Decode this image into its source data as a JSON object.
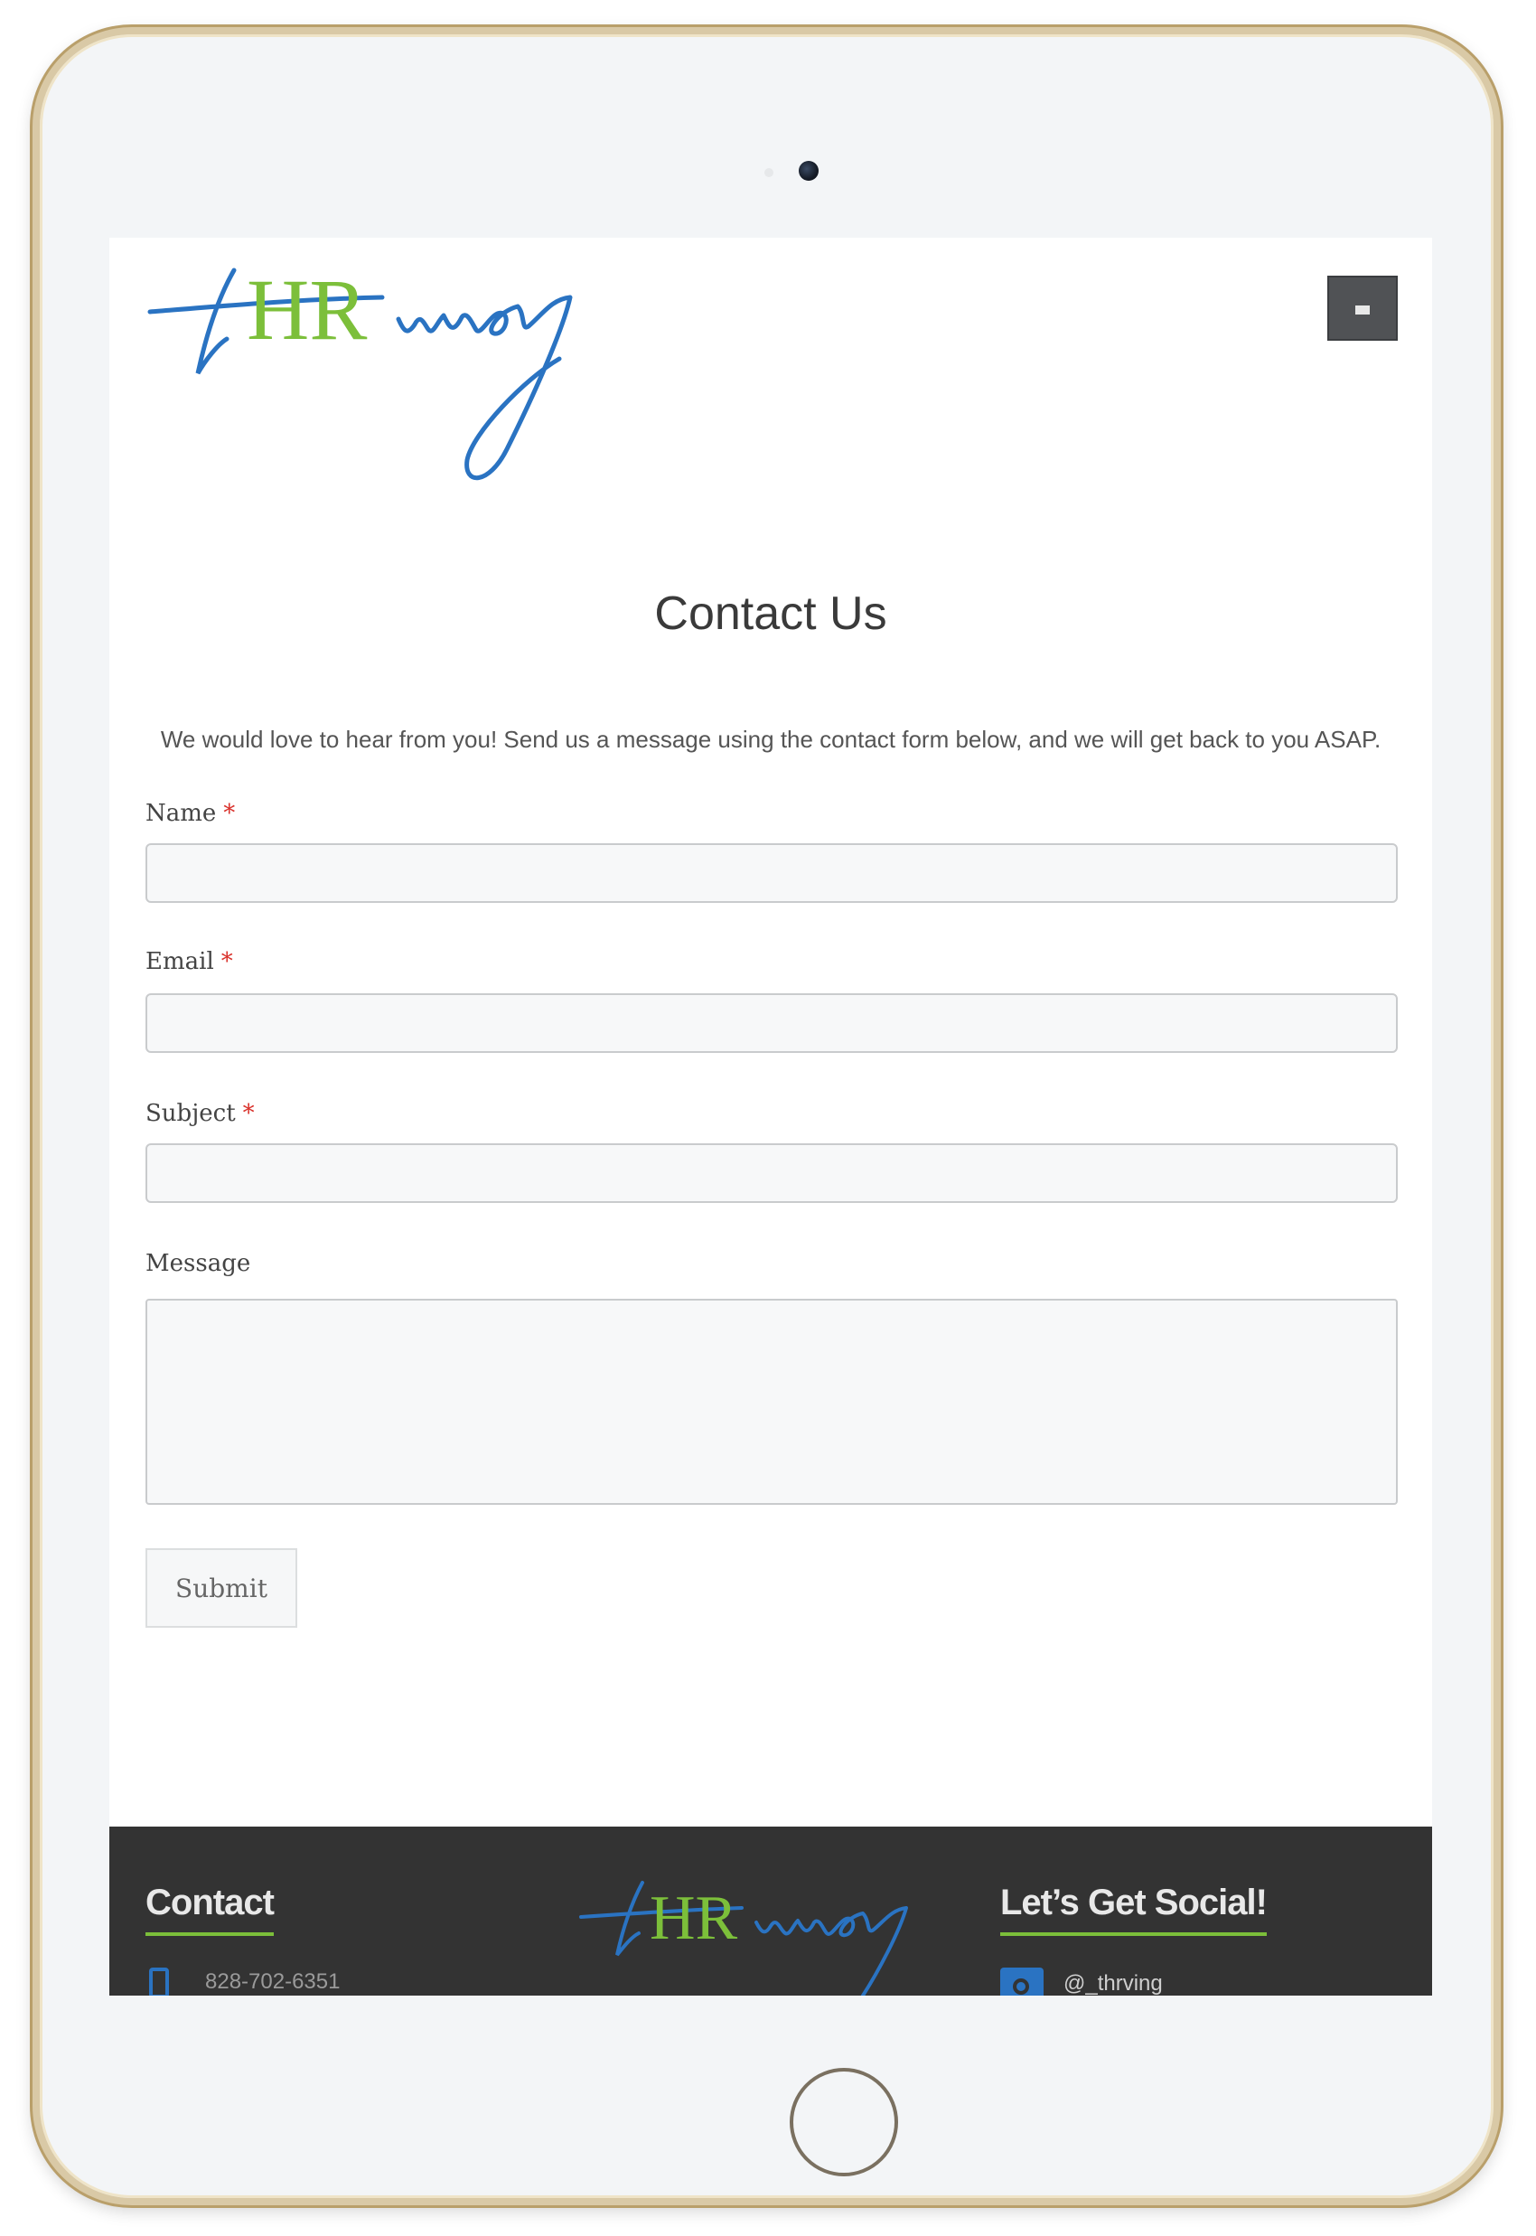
{
  "brand": {
    "logo_parts": [
      "t",
      "HR",
      "ving"
    ],
    "logo_word": "tHRving",
    "green": "#7cbf3a",
    "blue": "#2a73c2"
  },
  "header": {
    "menu_icon": "menu-icon"
  },
  "main": {
    "title": "Contact Us",
    "intro": "We would love to hear from you! Send us a message using the contact form below, and we will get back to you ASAP."
  },
  "form": {
    "name_label": "Name",
    "email_label": "Email",
    "subject_label": "Subject",
    "message_label": "Message",
    "required_mark": "*",
    "name_value": "",
    "email_value": "",
    "subject_value": "",
    "message_value": "",
    "submit_label": "Submit"
  },
  "footer": {
    "contact_heading": "Contact",
    "phone": "828-702-6351",
    "social_heading": "Let’s Get Social!",
    "instagram_handle": "@_thrving",
    "phone_icon": "phone-icon",
    "instagram_icon": "instagram-icon"
  }
}
